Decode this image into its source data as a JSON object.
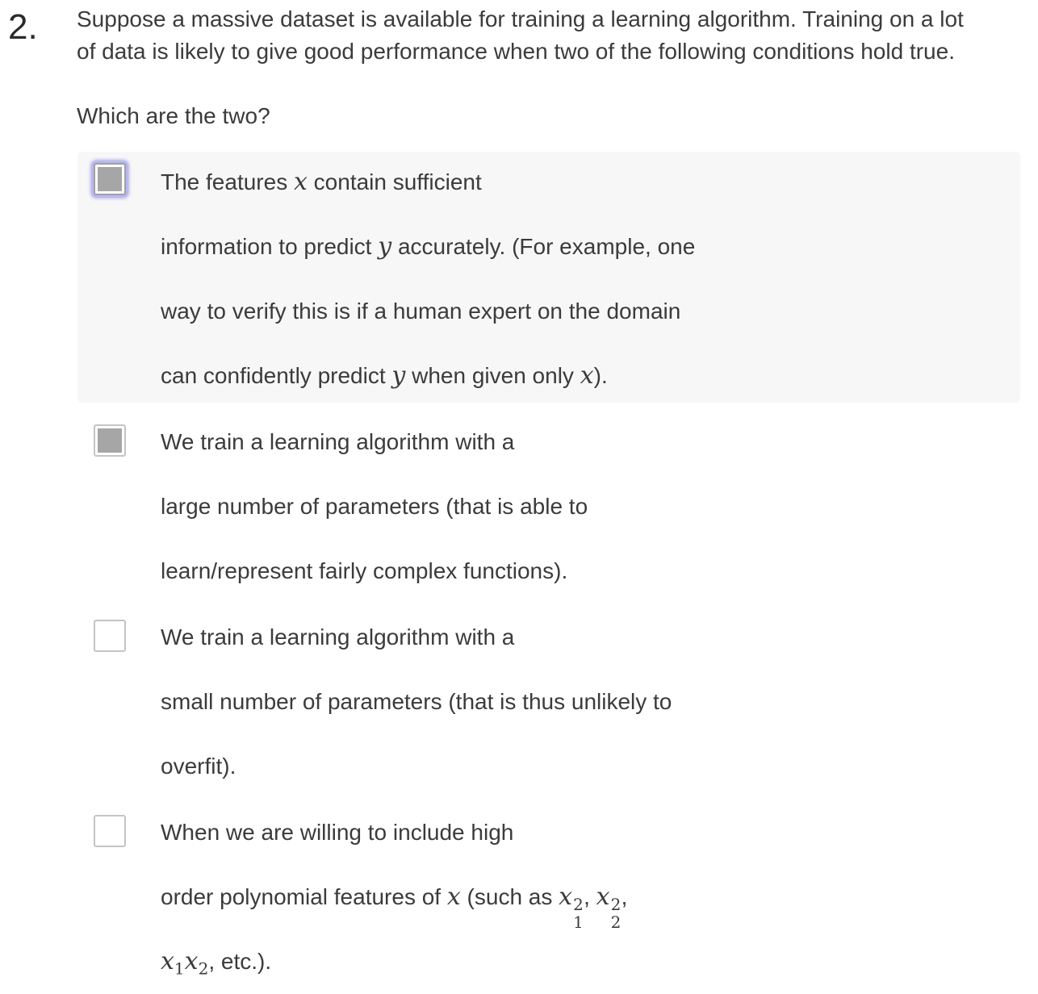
{
  "question": {
    "number": "2.",
    "prompt_line1": "Suppose a massive dataset is available for training a learning algorithm. Training on a lot",
    "prompt_line2": "of data is likely to give good performance when two of the following conditions hold true.",
    "subprompt": "Which are the two?"
  },
  "options": [
    {
      "checked": true,
      "focused": true,
      "lines": {
        "l1a": "The features ",
        "l1v": "x",
        "l1b": " contain sufficient",
        "l2a": "information to predict ",
        "l2v": "y",
        "l2b": " accurately. (For example, one",
        "l3": "way to verify this is if a human expert on the domain",
        "l4a": "can confidently predict ",
        "l4v1": "y",
        "l4b": " when given only ",
        "l4v2": "x",
        "l4c": ")."
      }
    },
    {
      "checked": true,
      "focused": false,
      "lines": {
        "l1": "We train a learning algorithm with a",
        "l2": "large number of parameters (that is able to",
        "l3": "learn/represent fairly complex functions)."
      }
    },
    {
      "checked": false,
      "focused": false,
      "lines": {
        "l1": "We train a learning algorithm with a",
        "l2": "small number of parameters (that is thus unlikely to",
        "l3": "overfit)."
      }
    },
    {
      "checked": false,
      "focused": false,
      "lines": {
        "l1": "When we are willing to include high",
        "l2a": "order polynomial features of ",
        "l2v": "x",
        "l2b": " (such as ",
        "m1": "x",
        "m1sup": "2",
        "m1sub": "1",
        "comma1": ", ",
        "m2": "x",
        "m2sup": "2",
        "m2sub": "2",
        "comma2": ",",
        "l3m1": "x",
        "l3m1sub": "1",
        "l3m2": "x",
        "l3m2sub": "2",
        "l3b": ", etc.)."
      }
    }
  ],
  "colors": {
    "text": "#3b3b3b",
    "highlight_bg": "#f7f7f7",
    "checkbox_fill": "#a6a6a6",
    "focus_ring": "#8e8ee8"
  }
}
